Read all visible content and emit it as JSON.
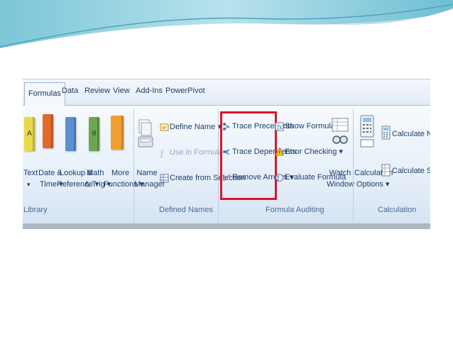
{
  "tabs": [
    "Formulas",
    "Data",
    "Review",
    "View",
    "Add-Ins",
    "PowerPivot"
  ],
  "library": {
    "text": "Text",
    "text_arrow": "▾",
    "datetime1": "Date &",
    "datetime2": "Time ▾",
    "lookup1": "Lookup &",
    "lookup2": "Reference ▾",
    "math1": "Math",
    "math2": "& Trig ▾",
    "more1": "More",
    "more2": "Functions ▾",
    "group": "Library",
    "book_text": "A",
    "book_math": "θ"
  },
  "names": {
    "manager1": "Name",
    "manager2": "Manager",
    "define": "Define Name ▾",
    "use": "Use in Formula ▾",
    "create": "Create from Selection",
    "group": "Defined Names"
  },
  "auditing": {
    "precedents": "Trace Precedents",
    "dependents": "Trace Dependents",
    "remove": "Remove Arrows ▾",
    "show": "Show Formulas",
    "error": "Error Checking ▾",
    "evaluate": "Evaluate Formula",
    "watch1": "Watch",
    "watch2": "Window",
    "group": "Formula Auditing"
  },
  "calculation": {
    "options1": "Calculation",
    "options2": "Options ▾",
    "now": "Calculate Now",
    "sheet": "Calculate Sheet",
    "group": "Calculation"
  },
  "colors": {
    "highlight": "#d9172b",
    "book_text": "#e8d84a",
    "book_date": "#e06a2b",
    "book_lookup": "#5b8fd6",
    "book_math": "#6aa84f",
    "book_more": "#f0a030"
  }
}
